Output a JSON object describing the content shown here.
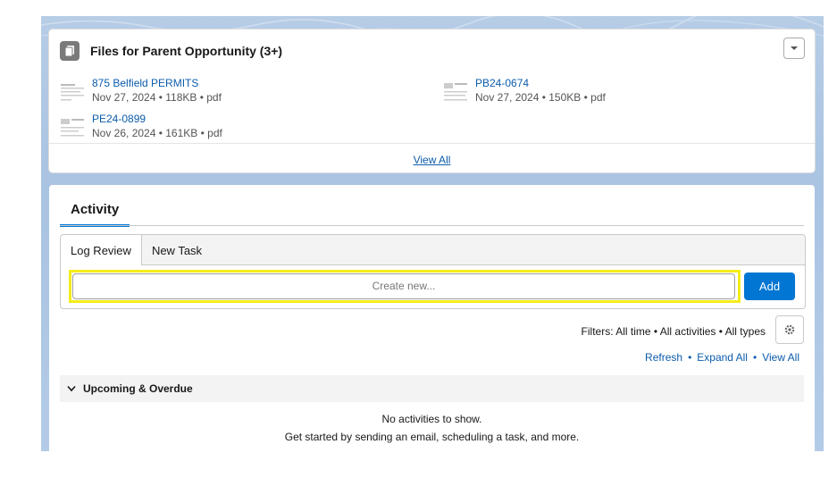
{
  "files": {
    "title": "Files for Parent Opportunity (3+)",
    "items": [
      {
        "name": "875 Belfield PERMITS",
        "meta": "Nov 27, 2024 • 118KB • pdf"
      },
      {
        "name": "PB24-0674",
        "meta": "Nov 27, 2024 • 150KB • pdf"
      },
      {
        "name": "PE24-0899",
        "meta": "Nov 26, 2024 • 161KB • pdf"
      }
    ],
    "view_all": "View All"
  },
  "activity": {
    "tab": "Activity",
    "subtabs": [
      "Log Review",
      "New Task"
    ],
    "composer_placeholder": "Create new...",
    "add_label": "Add",
    "filters": "Filters: All time • All activities • All types",
    "links": [
      "Refresh",
      "Expand All",
      "View All"
    ],
    "section_title": "Upcoming & Overdue",
    "empty_title": "No activities to show.",
    "empty_sub": "Get started by sending an email, scheduling a task, and more."
  },
  "colors": {
    "accent": "#0176d3",
    "link": "#0b5cab",
    "highlight": "#f4ec1b"
  },
  "icons": [
    "file-copy-icon",
    "chevron-down-icon",
    "gear-icon",
    "pdf-thumbnail-icon"
  ]
}
